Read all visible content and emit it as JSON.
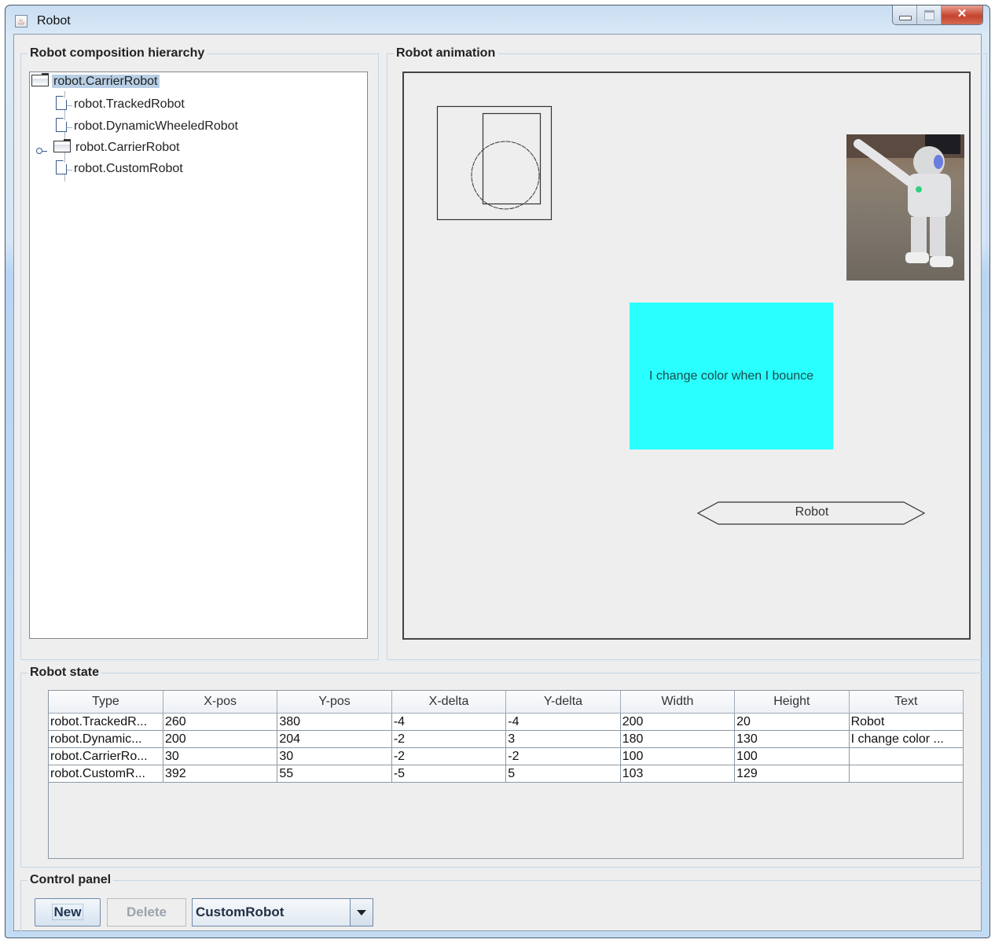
{
  "window": {
    "title": "Robot",
    "controls": {
      "minimize": "minimize",
      "maximize": "maximize",
      "close": "close"
    }
  },
  "hierarchy": {
    "title": "Robot composition hierarchy",
    "root": {
      "label": "robot.CarrierRobot",
      "icon": "folder-icon",
      "selected": true
    },
    "children": [
      {
        "label": "robot.TrackedRobot",
        "icon": "file-icon"
      },
      {
        "label": "robot.DynamicWheeledRobot",
        "icon": "file-icon"
      },
      {
        "label": "robot.CarrierRobot",
        "icon": "folder-icon",
        "collapsed": true
      },
      {
        "label": "robot.CustomRobot",
        "icon": "file-icon"
      }
    ]
  },
  "animation": {
    "title": "Robot animation",
    "cyan_robot_text": "I change color when I bounce",
    "cyan_color": "#2affff",
    "tracked_robot_text": "Robot",
    "photo": "nao-robot-photo"
  },
  "state": {
    "title": "Robot state",
    "columns": [
      "Type",
      "X-pos",
      "Y-pos",
      "X-delta",
      "Y-delta",
      "Width",
      "Height",
      "Text"
    ],
    "rows": [
      [
        "robot.TrackedR...",
        "260",
        "380",
        "-4",
        "-4",
        "200",
        "20",
        "Robot"
      ],
      [
        "robot.Dynamic...",
        "200",
        "204",
        "-2",
        "3",
        "180",
        "130",
        "I change color ..."
      ],
      [
        "robot.CarrierRo...",
        "30",
        "30",
        "-2",
        "-2",
        "100",
        "100",
        ""
      ],
      [
        "robot.CustomR...",
        "392",
        "55",
        "-5",
        "5",
        "103",
        "129",
        ""
      ]
    ]
  },
  "control": {
    "title": "Control panel",
    "new_label": "New",
    "delete_label": "Delete",
    "delete_enabled": false,
    "robot_type_selected": "CustomRobot"
  }
}
